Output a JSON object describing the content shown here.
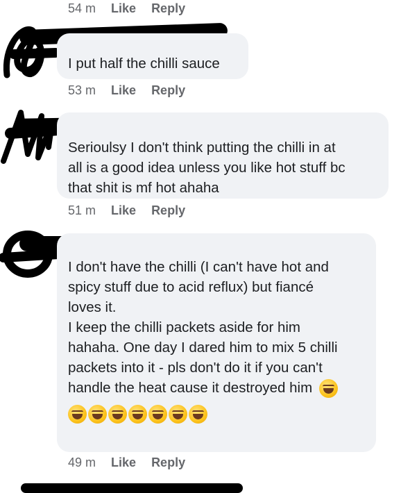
{
  "comments": [
    {
      "time": "54 m",
      "like": "Like",
      "reply": "Reply"
    },
    {
      "text": "I put half the chilli sauce",
      "time": "53 m",
      "like": "Like",
      "reply": "Reply"
    },
    {
      "text": "Serioulsy I don't think putting the chilli in at\nall is a good idea unless you like hot stuff bc\nthat shit is mf hot ahaha",
      "time": "51 m",
      "like": "Like",
      "reply": "Reply"
    },
    {
      "text1": "I don't have the chilli (I can't have hot and\nspicy stuff due to acid reflux) but fiancé\nloves it.",
      "text2": "I keep the chilli packets aside for him\nhahaha. One day I dared him to mix 5 chilli\npackets into it - pls don't do it if you can't\nhandle the heat cause it destroyed him",
      "time": "49 m",
      "like": "Like",
      "reply": "Reply",
      "emoji": "face-with-tears-of-joy",
      "emoji_count": 8
    }
  ],
  "colors": {
    "bubble": "#f0f2f5",
    "meta": "#65676b",
    "redaction": "#000000"
  }
}
